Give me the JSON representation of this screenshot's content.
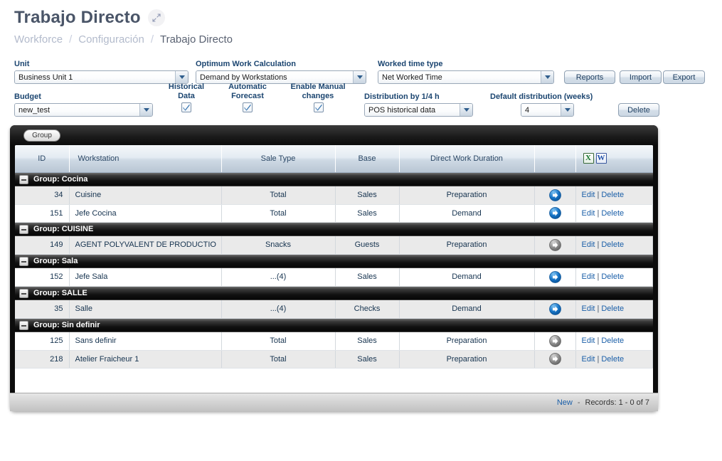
{
  "header": {
    "title": "Trabajo Directo",
    "expand_icon": "expand-arrows-icon",
    "breadcrumb": [
      {
        "label": "Workforce",
        "current": false
      },
      {
        "label": "Configuración",
        "current": false
      },
      {
        "label": "Trabajo Directo",
        "current": true
      }
    ],
    "breadcrumb_separator": "/"
  },
  "filters": {
    "unit": {
      "label": "Unit",
      "value": "Business Unit 1"
    },
    "optimum_work_calculation": {
      "label": "Optimum Work Calculation",
      "value": "Demand by Workstations"
    },
    "worked_time_type": {
      "label": "Worked time type",
      "value": "Net Worked Time"
    },
    "budget": {
      "label": "Budget",
      "value": "new_test"
    },
    "historical_data": {
      "label_line1": "Historical",
      "label_line2": "Data",
      "checked": true
    },
    "automatic_forecast": {
      "label_line1": "Automatic",
      "label_line2": "Forecast",
      "checked": true
    },
    "enable_manual_changes": {
      "label_line1": "Enable Manual",
      "label_line2": "changes",
      "checked": true
    },
    "distribution_quarter": {
      "label": "Distribution by 1/4 h",
      "value": "POS historical data"
    },
    "default_distribution": {
      "label": "Default distribution (weeks)",
      "value": "4"
    },
    "buttons": {
      "reports": "Reports",
      "import": "Import",
      "export": "Export",
      "delete": "Delete"
    }
  },
  "grid": {
    "toolbar": {
      "group_button": "Group"
    },
    "columns": [
      "ID",
      "Workstation",
      "Sale Type",
      "Base",
      "Direct Work Duration"
    ],
    "export_icons": {
      "excel": "X",
      "word": "W"
    },
    "group_prefix": "Group: ",
    "actions": {
      "edit": "Edit",
      "delete": "Delete",
      "separator": "|"
    },
    "groups": [
      {
        "name": "Cocina",
        "rows": [
          {
            "id": "34",
            "workstation": "Cuisine",
            "sale_type": "Total",
            "base": "Sales",
            "duration": "Preparation",
            "arrow": "blue"
          },
          {
            "id": "151",
            "workstation": "Jefe Cocina",
            "sale_type": "Total",
            "base": "Sales",
            "duration": "Demand",
            "arrow": "blue"
          }
        ]
      },
      {
        "name": "CUISINE",
        "rows": [
          {
            "id": "149",
            "workstation": "AGENT POLYVALENT DE PRODUCTIO",
            "sale_type": "Snacks",
            "base": "Guests",
            "duration": "Preparation",
            "arrow": "gray"
          }
        ]
      },
      {
        "name": "Sala",
        "rows": [
          {
            "id": "152",
            "workstation": "Jefe Sala",
            "sale_type": "...(4)",
            "base": "Sales",
            "duration": "Demand",
            "arrow": "blue"
          }
        ]
      },
      {
        "name": "SALLE",
        "rows": [
          {
            "id": "35",
            "workstation": "Salle",
            "sale_type": "...(4)",
            "base": "Checks",
            "duration": "Demand",
            "arrow": "blue"
          }
        ]
      },
      {
        "name": "Sin definir",
        "rows": [
          {
            "id": "125",
            "workstation": "Sans definir",
            "sale_type": "Total",
            "base": "Sales",
            "duration": "Preparation",
            "arrow": "gray"
          },
          {
            "id": "218",
            "workstation": "Atelier Fraicheur 1",
            "sale_type": "Total",
            "base": "Sales",
            "duration": "Preparation",
            "arrow": "gray"
          }
        ]
      }
    ],
    "footer": {
      "new_label": "New",
      "dash": "-",
      "records": "Records: 1 - 0 of 7"
    }
  },
  "colors": {
    "title": "#4a5568",
    "breadcrumb_muted": "#b3bbcc",
    "label_blue": "#1b4570",
    "link_blue": "#1b5fa8",
    "panel_black": "#0c0c0c",
    "arrow_blue": "#1e7fd4",
    "arrow_gray": "#8e8e8e",
    "excel_green": "#17772f",
    "word_blue": "#1f4fa8"
  }
}
